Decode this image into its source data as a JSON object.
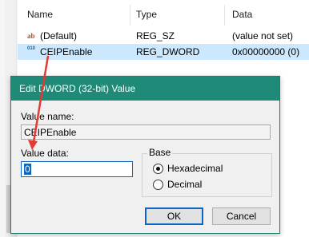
{
  "columns": {
    "name": "Name",
    "type": "Type",
    "data": "Data"
  },
  "rows": [
    {
      "icon": "ab",
      "name": "(Default)",
      "type": "REG_SZ",
      "data": "(value not set)"
    },
    {
      "icon": "010",
      "name": "CEIPEnable",
      "type": "REG_DWORD",
      "data": "0x00000000 (0)"
    }
  ],
  "dialog": {
    "title": "Edit DWORD (32-bit) Value",
    "value_name_label": "Value name:",
    "value_name": "CEIPEnable",
    "value_data_label": "Value data:",
    "value_data": "0",
    "base_label": "Base",
    "hex_label": "Hexadecimal",
    "dec_label": "Decimal",
    "ok_label": "OK",
    "cancel_label": "Cancel"
  },
  "colors": {
    "titlebar": "#1e8a77",
    "selection": "#cce8ff",
    "arrow": "#e53935"
  }
}
